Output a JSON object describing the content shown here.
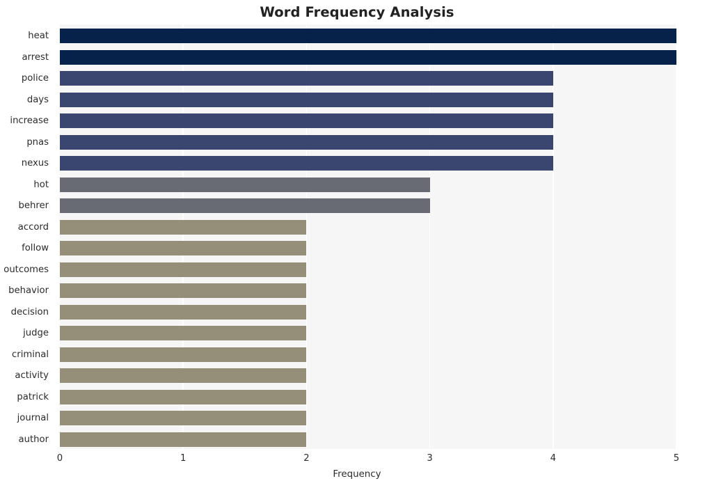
{
  "chart_data": {
    "type": "bar",
    "orientation": "horizontal",
    "title": "Word Frequency Analysis",
    "xlabel": "Frequency",
    "ylabel": "",
    "categories": [
      "heat",
      "arrest",
      "police",
      "days",
      "increase",
      "pnas",
      "nexus",
      "hot",
      "behrer",
      "accord",
      "follow",
      "outcomes",
      "behavior",
      "decision",
      "judge",
      "criminal",
      "activity",
      "patrick",
      "journal",
      "author"
    ],
    "values": [
      5,
      5,
      4,
      4,
      4,
      4,
      4,
      3,
      3,
      2,
      2,
      2,
      2,
      2,
      2,
      2,
      2,
      2,
      2,
      2
    ],
    "xlim": [
      0,
      5
    ],
    "xticks": [
      "0",
      "1",
      "2",
      "3",
      "4",
      "5"
    ],
    "xtick_values": [
      0,
      1,
      2,
      3,
      4,
      5
    ],
    "grid": true,
    "grid_axis": "x",
    "legend": "none",
    "bar_colors": [
      "#06224b",
      "#06224b",
      "#3a4670",
      "#3a4670",
      "#3a4670",
      "#3a4670",
      "#3a4670",
      "#686b74",
      "#686b74",
      "#958e78",
      "#958e78",
      "#958e78",
      "#958e78",
      "#958e78",
      "#958e78",
      "#958e78",
      "#958e78",
      "#958e78",
      "#958e78",
      "#958e78"
    ],
    "palette": {
      "freq_5": "#06224b",
      "freq_4": "#3a4670",
      "freq_3": "#686b74",
      "freq_2": "#958e78"
    },
    "style": {
      "plot_background": "#f6f6f7",
      "figure_background": "#ffffff",
      "gridline_color": "#ffffff",
      "text_color": "#2b2b2b"
    }
  }
}
